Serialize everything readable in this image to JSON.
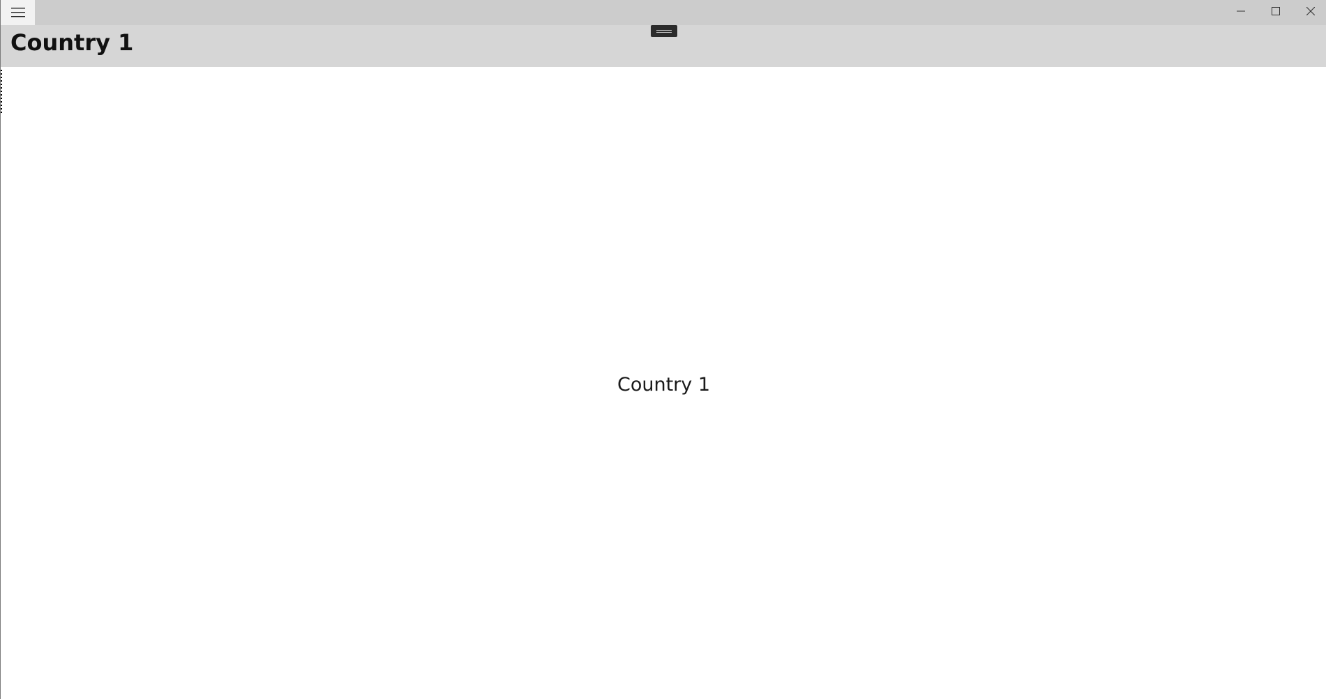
{
  "header": {
    "title": "Country 1"
  },
  "main": {
    "content_text": "Country 1"
  },
  "titlebar": {
    "menu_icon": "hamburger-menu-icon",
    "minimize_icon": "minimize-icon",
    "maximize_icon": "maximize-icon",
    "close_icon": "close-icon"
  },
  "colors": {
    "titlebar_bg": "#cccccc",
    "header_bg": "#d6d6d6",
    "content_bg": "#ffffff",
    "text": "#111111"
  }
}
